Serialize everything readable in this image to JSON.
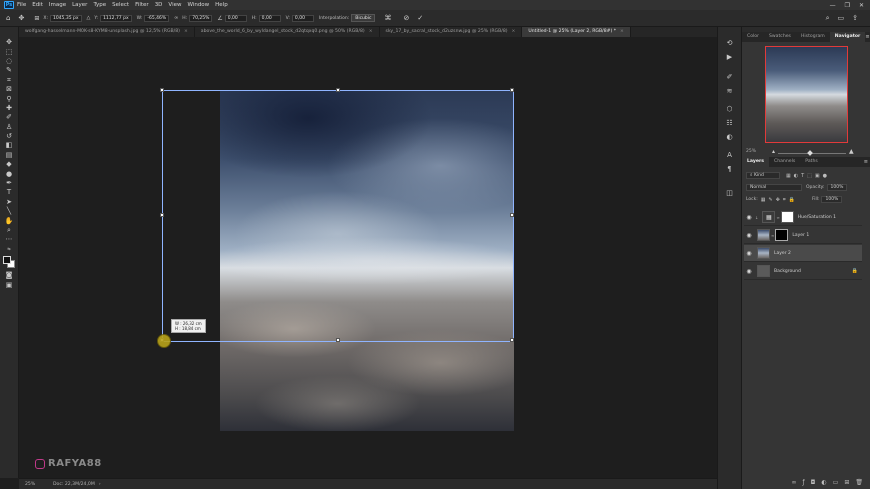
{
  "app": {
    "logo": "Ps",
    "menu": [
      "File",
      "Edit",
      "Image",
      "Layer",
      "Type",
      "Select",
      "Filter",
      "3D",
      "View",
      "Window",
      "Help"
    ],
    "window_controls": [
      "—",
      "❐",
      "✕"
    ]
  },
  "options": {
    "x_label": "X:",
    "x_value": "1045,35 px",
    "y_label": "Y:",
    "y_value": "1112,77 px",
    "w_label": "W:",
    "w_value": "-65,46%",
    "h_label": "H:",
    "h_value": "70,25%",
    "angle_value": "0,00",
    "hskew_label": "H:",
    "hskew_value": "0,00",
    "vskew_label": "V:",
    "vskew_value": "0,00",
    "interp_label": "Interpolation:",
    "interp_value": "Bicubic",
    "cancel_icon": "cancel-icon",
    "commit_icon": "commit-icon"
  },
  "tabs": [
    {
      "label": "wolfgang-hasselmann-M0K-s8-KYM8-unsplash.jpg @ 12,5% (RGB/8)",
      "active": false
    },
    {
      "label": "above_the_world_6_by_wyldangel_stock_d2qtqxq0.png @ 50% (RGB/8)",
      "active": false
    },
    {
      "label": "sky_17_by_sacral_stock_d2uzsnw.jpg @ 25% (RGB/8)",
      "active": false
    },
    {
      "label": "Untitled-1 @ 25% (Layer 2, RGB/8#) *",
      "active": true
    }
  ],
  "canvas": {
    "size_tip_w": "W :   26,32 cm",
    "size_tip_h": "H :   18,84 cm"
  },
  "watermark": "RAFYA88",
  "status": {
    "zoom": "25%",
    "doc": "Doc: 22,3M/24,0M"
  },
  "navigator": {
    "tabs": [
      {
        "label": "Color",
        "active": false
      },
      {
        "label": "Swatches",
        "active": false
      },
      {
        "label": "Histogram",
        "active": false
      },
      {
        "label": "Navigator",
        "active": true
      }
    ],
    "zoom": "25%"
  },
  "layers_panel": {
    "tabs": [
      {
        "label": "Layers",
        "active": true
      },
      {
        "label": "Channels",
        "active": false
      },
      {
        "label": "Paths",
        "active": false
      }
    ],
    "filter_label": "Kind",
    "blend_mode": "Normal",
    "opacity_label": "Opacity:",
    "opacity_value": "100%",
    "lock_label": "Lock:",
    "fill_label": "Fill:",
    "fill_value": "100%",
    "layers": [
      {
        "name": "Hue/Saturation 1",
        "selected": false
      },
      {
        "name": "Layer 1",
        "selected": false
      },
      {
        "name": "Layer 2",
        "selected": true
      },
      {
        "name": "Background",
        "selected": false
      }
    ]
  }
}
